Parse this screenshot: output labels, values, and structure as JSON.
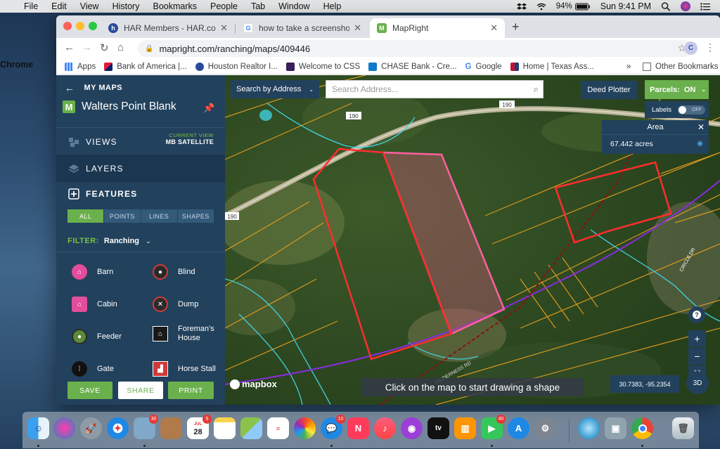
{
  "menubar": {
    "app": "Chrome",
    "items": [
      "File",
      "Edit",
      "View",
      "History",
      "Bookmarks",
      "People",
      "Tab",
      "Window",
      "Help"
    ],
    "battery": "94%",
    "clock": "Sun 9:41 PM"
  },
  "browser": {
    "tabs": [
      {
        "title": "HAR Members - HAR.com",
        "favicon": "har-icon"
      },
      {
        "title": "how to take a screenshot of m",
        "favicon": "google-icon"
      },
      {
        "title": "MapRight",
        "favicon": "mapright-icon"
      }
    ],
    "url": "mapright.com/ranching/maps/409446",
    "profile_initial": "C",
    "bookmarks": [
      "Apps",
      "Bank of America |...",
      "Houston Realtor I...",
      "Welcome to CSS",
      "CHASE Bank - Cre...",
      "Google",
      "Home | Texas Ass..."
    ],
    "bookmarks_more": "»",
    "other_bookmarks": "Other Bookmarks"
  },
  "sidebar": {
    "back_label": "MY MAPS",
    "map_logo": "M",
    "map_title": "Walters Point Blank",
    "views_label": "VIEWS",
    "current_view_key": "CURRENT VIEW",
    "current_view_value": "MB SATELLITE",
    "layers_label": "LAYERS",
    "features_label": "FEATURES",
    "segments": [
      "ALL",
      "POINTS",
      "LINES",
      "SHAPES"
    ],
    "active_segment": "ALL",
    "filter_key": "FILTER:",
    "filter_value": "Ranching",
    "features": [
      {
        "label": "Barn",
        "icon": "barn-icon"
      },
      {
        "label": "Blind",
        "icon": "blind-icon"
      },
      {
        "label": "Cabin",
        "icon": "cabin-icon"
      },
      {
        "label": "Dump",
        "icon": "dump-icon"
      },
      {
        "label": "Feeder",
        "icon": "feeder-icon"
      },
      {
        "label": "Foreman's House",
        "icon": "foremans-house-icon"
      },
      {
        "label": "Gate",
        "icon": "gate-icon"
      },
      {
        "label": "Horse Stall",
        "icon": "horse-stall-icon"
      }
    ],
    "save_label": "SAVE",
    "share_label": "SHARE",
    "print_label": "PRINT"
  },
  "map": {
    "search_mode": "Search by Address",
    "search_placeholder": "Search Address...",
    "deed_plotter": "Deed Plotter",
    "parcels_label": "Parcels:",
    "parcels_state": "ON",
    "labels_label": "Labels",
    "labels_state": "OFF",
    "area_title": "Area",
    "area_value": "67.442 acres",
    "road_190": "190",
    "road_label": "WILDERNESS RD",
    "road_label_2": "CIRCLE DR",
    "attribution": "mapbox",
    "hint": "Click on the map to start drawing a shape",
    "coordinates": "30.7383, -95.2354",
    "btn_3d": "3D",
    "colors": {
      "parcel_lines": "#e8a020",
      "boundary": "#ff2d2d",
      "powerline": "#8a2be2",
      "water": "#3fd0e0",
      "panel": "#22415c",
      "accent": "#6ab04c"
    }
  },
  "dock": {
    "badges": {
      "calendar_month": "JUL",
      "calendar_day": "28",
      "calendar": "5",
      "photos_app": "30",
      "messages": "10",
      "facetime": "40"
    }
  }
}
